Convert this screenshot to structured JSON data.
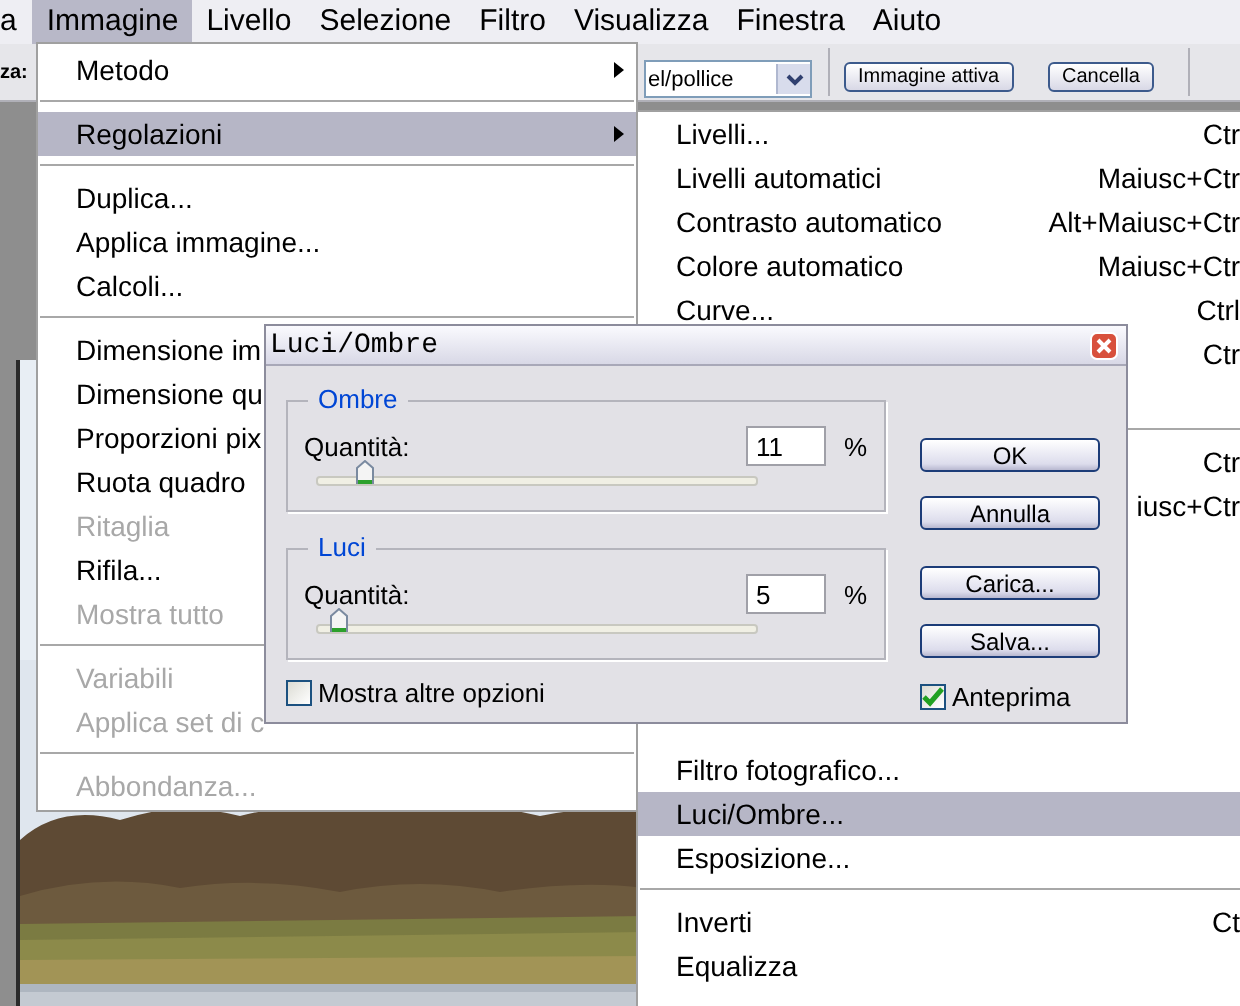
{
  "menubar": [
    {
      "label": "a",
      "selected": false
    },
    {
      "label": "Immagine",
      "selected": true
    },
    {
      "label": "Livello",
      "selected": false
    },
    {
      "label": "Selezione",
      "selected": false
    },
    {
      "label": "Filtro",
      "selected": false
    },
    {
      "label": "Visualizza",
      "selected": false
    },
    {
      "label": "Finestra",
      "selected": false
    },
    {
      "label": "Aiuto",
      "selected": false
    }
  ],
  "options_bar": {
    "label": "za:",
    "units_dropdown": {
      "value": "el/pollice"
    },
    "buttons": [
      "Immagine attiva",
      "Cancella"
    ]
  },
  "image_menu": {
    "items": [
      {
        "kind": "item",
        "label": "Metodo",
        "submenu": true,
        "selected": false,
        "disabled": false
      },
      {
        "kind": "separator"
      },
      {
        "kind": "item",
        "label": "Regolazioni",
        "submenu": true,
        "selected": true,
        "disabled": false
      },
      {
        "kind": "separator"
      },
      {
        "kind": "item",
        "label": "Duplica...",
        "submenu": false,
        "selected": false,
        "disabled": false
      },
      {
        "kind": "item",
        "label": "Applica immagine...",
        "submenu": false,
        "selected": false,
        "disabled": false
      },
      {
        "kind": "item",
        "label": "Calcoli...",
        "submenu": false,
        "selected": false,
        "disabled": false
      },
      {
        "kind": "separator"
      },
      {
        "kind": "item",
        "label": "Dimensione im",
        "selected": false,
        "disabled": false
      },
      {
        "kind": "item",
        "label": "Dimensione qu",
        "selected": false,
        "disabled": false
      },
      {
        "kind": "item",
        "label": "Proporzioni pix",
        "selected": false,
        "disabled": false
      },
      {
        "kind": "item",
        "label": "Ruota quadro",
        "selected": false,
        "disabled": false
      },
      {
        "kind": "item",
        "label": "Ritaglia",
        "selected": false,
        "disabled": true
      },
      {
        "kind": "item",
        "label": "Rifila...",
        "selected": false,
        "disabled": false
      },
      {
        "kind": "item",
        "label": "Mostra tutto",
        "selected": false,
        "disabled": true
      },
      {
        "kind": "separator"
      },
      {
        "kind": "item",
        "label": "Variabili",
        "selected": false,
        "disabled": true
      },
      {
        "kind": "item",
        "label": "Applica set di c",
        "selected": false,
        "disabled": true
      },
      {
        "kind": "separator"
      },
      {
        "kind": "item",
        "label": "Abbondanza...",
        "submenu": false,
        "selected": false,
        "disabled": true
      }
    ]
  },
  "adjustments_submenu": {
    "upper_items": [
      {
        "kind": "item",
        "label": "Livelli...",
        "shortcut": "Ctr",
        "selected": false
      },
      {
        "kind": "item",
        "label": "Livelli automatici",
        "shortcut": "Maiusc+Ctr",
        "selected": false
      },
      {
        "kind": "item",
        "label": "Contrasto automatico",
        "shortcut": "Alt+Maiusc+Ctr",
        "selected": false
      },
      {
        "kind": "item",
        "label": "Colore automatico",
        "shortcut": "Maiusc+Ctr",
        "selected": false
      },
      {
        "kind": "item",
        "label": "Curve...",
        "shortcut": "Ctrl",
        "selected": false
      },
      {
        "kind": "item",
        "shortcut": "Ctr",
        "selected": false
      },
      {
        "kind": "separator"
      },
      {
        "kind": "item",
        "shortcut": "Ctr",
        "selected": false
      },
      {
        "kind": "item",
        "shortcut": "iusc+Ctr",
        "selected": false
      }
    ],
    "lower_items": [
      {
        "kind": "item",
        "label": "Filtro fotografico...",
        "selected": false
      },
      {
        "kind": "item",
        "label": "Luci/Ombre...",
        "selected": true
      },
      {
        "kind": "item",
        "label": "Esposizione...",
        "selected": false
      },
      {
        "kind": "separator"
      },
      {
        "kind": "item",
        "label": "Inverti",
        "shortcut": "Ct",
        "selected": false
      },
      {
        "kind": "item",
        "label": "Equalizza",
        "selected": false
      }
    ]
  },
  "dialog": {
    "title": "Luci/Ombre",
    "groups": [
      {
        "title": "Ombre",
        "label": "Quantità:",
        "value": "11",
        "unit": "%",
        "level": 0.11
      },
      {
        "title": "Luci",
        "label": "Quantità:",
        "value": "5",
        "unit": "%",
        "level": 0.05
      }
    ],
    "more_options": {
      "label": "Mostra altre opzioni",
      "checked": false
    },
    "buttons": [
      "OK",
      "Annulla",
      "Carica...",
      "Salva..."
    ],
    "preview": {
      "label": "Anteprima",
      "checked": true
    }
  }
}
